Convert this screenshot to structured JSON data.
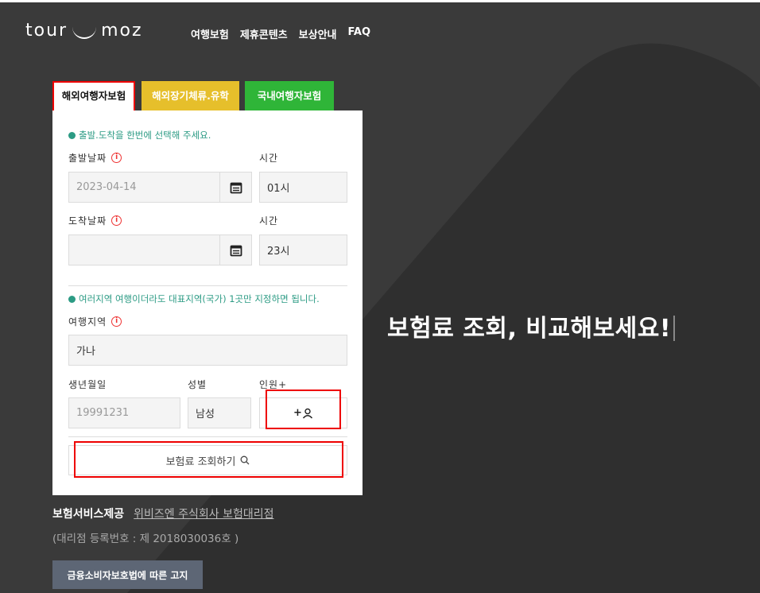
{
  "brand": {
    "logo_left": "tour",
    "logo_right": "moz"
  },
  "nav": [
    "여행보험",
    "제휴콘텐츠",
    "보상안내",
    "FAQ"
  ],
  "tabs": [
    "해외여행자보험",
    "해외장기체류.유학",
    "국내여행자보험"
  ],
  "form": {
    "note_dates": "출발.도착을 한번에 선택해 주세요.",
    "departure_label": "출발날짜",
    "departure_value": "2023-04-14",
    "departure_time_label": "시간",
    "departure_time_value": "01시",
    "arrival_label": "도착날짜",
    "arrival_value": "",
    "arrival_time_label": "시간",
    "arrival_time_value": "23시",
    "note_region": "여러지역 여행이더라도 대표지역(국가) 1곳만 지정하면 됩니다.",
    "region_label": "여행지역",
    "region_value": "가나",
    "birth_label": "생년월일",
    "birth_placeholder": "19991231",
    "gender_label": "성별",
    "gender_value": "남성",
    "people_label": "인원+",
    "add_person_text": "+",
    "search_button": "보험료 조회하기"
  },
  "headline": "보험료 조회, 비교해보세요!",
  "footer": {
    "provider_label": "보험서비스제공",
    "provider_link": "위비즈엔 주식회사 보험대리점",
    "reg_no": "(대리점 등록번호 : 제 2018030036호 )",
    "notice_button": "금융소비자보호법에 따른 고지"
  },
  "colors": {
    "tab2": "#e6bf2b",
    "tab3": "#2fb538",
    "note": "#2c9b84",
    "highlight": "#e00000"
  }
}
